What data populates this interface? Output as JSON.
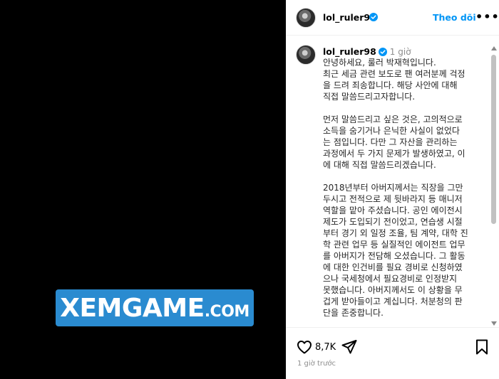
{
  "media": {
    "watermark_main": "XEMGAME",
    "watermark_suffix": ".COM"
  },
  "header": {
    "username": "lol_ruler98",
    "follow_label": "Theo dõi",
    "more_label": "•••"
  },
  "comment": {
    "username": "lol_ruler98",
    "time": "1 giờ",
    "caption": "안녕하세요, 룰러 박재혁입니다.\n최근 세금 관련 보도로 팬 여러분께 걱정\n을 드려 죄송합니다. 해당 사안에 대해\n직접 말씀드리고자합니다.\n\n먼저 말씀드리고 싶은 것은, 고의적으로\n소득을 숨기거나 은닉한 사실이 없었다\n는 점입니다. 다만 그 자산을 관리하는\n과정에서 두 가지 문제가 발생하였고, 이\n에 대해 직접 말씀드리겠습니다.\n\n2018년부터 아버지께서는 직장을 그만\n두시고 전적으로 제 뒷바라지 등 매니저\n역할을 맡아 주셨습니다. 공인 에이전시\n제도가 도입되기 전이었고, 연습생 시절\n부터 경기 외 일정 조율, 팀 계약, 대학 진\n학 관련 업무 등 실질적인 에이전트 업무\n를 아버지가 전담해 오셨습니다. 그 활동\n에 대한 인건비를 필요 경비로 신청하였\n으나 국세청에서 필요경비로 인정받지\n못했습니다. 아버지께서도 이 상황을 무\n겁게 받아들이고 계십니다. 처분청의 판\n단을 존중합니다."
  },
  "actions": {
    "like_count": "8,7K",
    "post_time": "1 giờ trước"
  },
  "colors": {
    "accent": "#0095f6",
    "watermark_bg": "#2a8bd0",
    "muted": "#8e8e8e"
  },
  "icons": [
    "verified-badge-icon",
    "heart-icon",
    "share-icon",
    "bookmark-icon",
    "more-icon"
  ]
}
